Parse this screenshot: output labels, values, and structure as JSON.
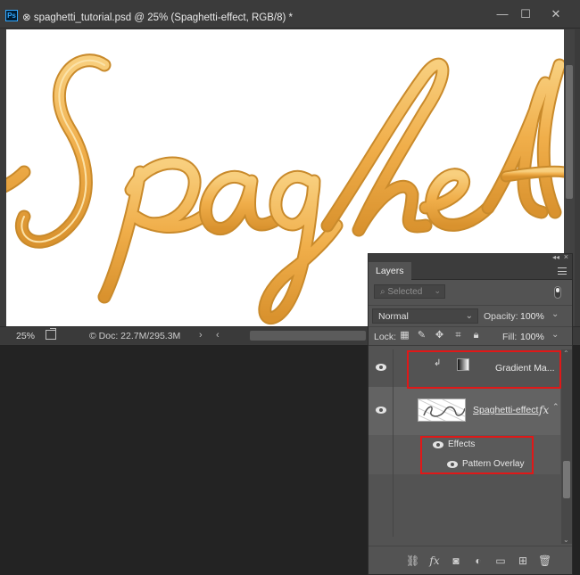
{
  "document": {
    "title": "spaghetti_tutorial.psd @ 25% (Spaghetti-effect, RGB/8) *",
    "app_icon_label": "Ps",
    "status": {
      "zoom": "25%",
      "doc_info": "Doc: 22.7M/295.3M"
    }
  },
  "panel": {
    "tab_label": "Layers",
    "filter_placeholder": "Selected",
    "blend_mode": "Normal",
    "opacity_label": "Opacity:",
    "opacity_value": "100%",
    "lock_label": "Lock:",
    "fill_label": "Fill:",
    "fill_value": "100%",
    "layers": [
      {
        "name": "Gradient Ma...",
        "type": "gradient-map",
        "clipped": true
      },
      {
        "name": "Spaghetti-effect",
        "type": "pixel",
        "fx_label": "fx",
        "effects_label": "Effects",
        "effects": [
          "Pattern Overlay"
        ]
      }
    ]
  },
  "colors": {
    "spaghetti_fill": "#f2b75a",
    "spaghetti_edge": "#c98a2b",
    "highlight": "#e01818",
    "ps_accent": "#31a8ff"
  }
}
